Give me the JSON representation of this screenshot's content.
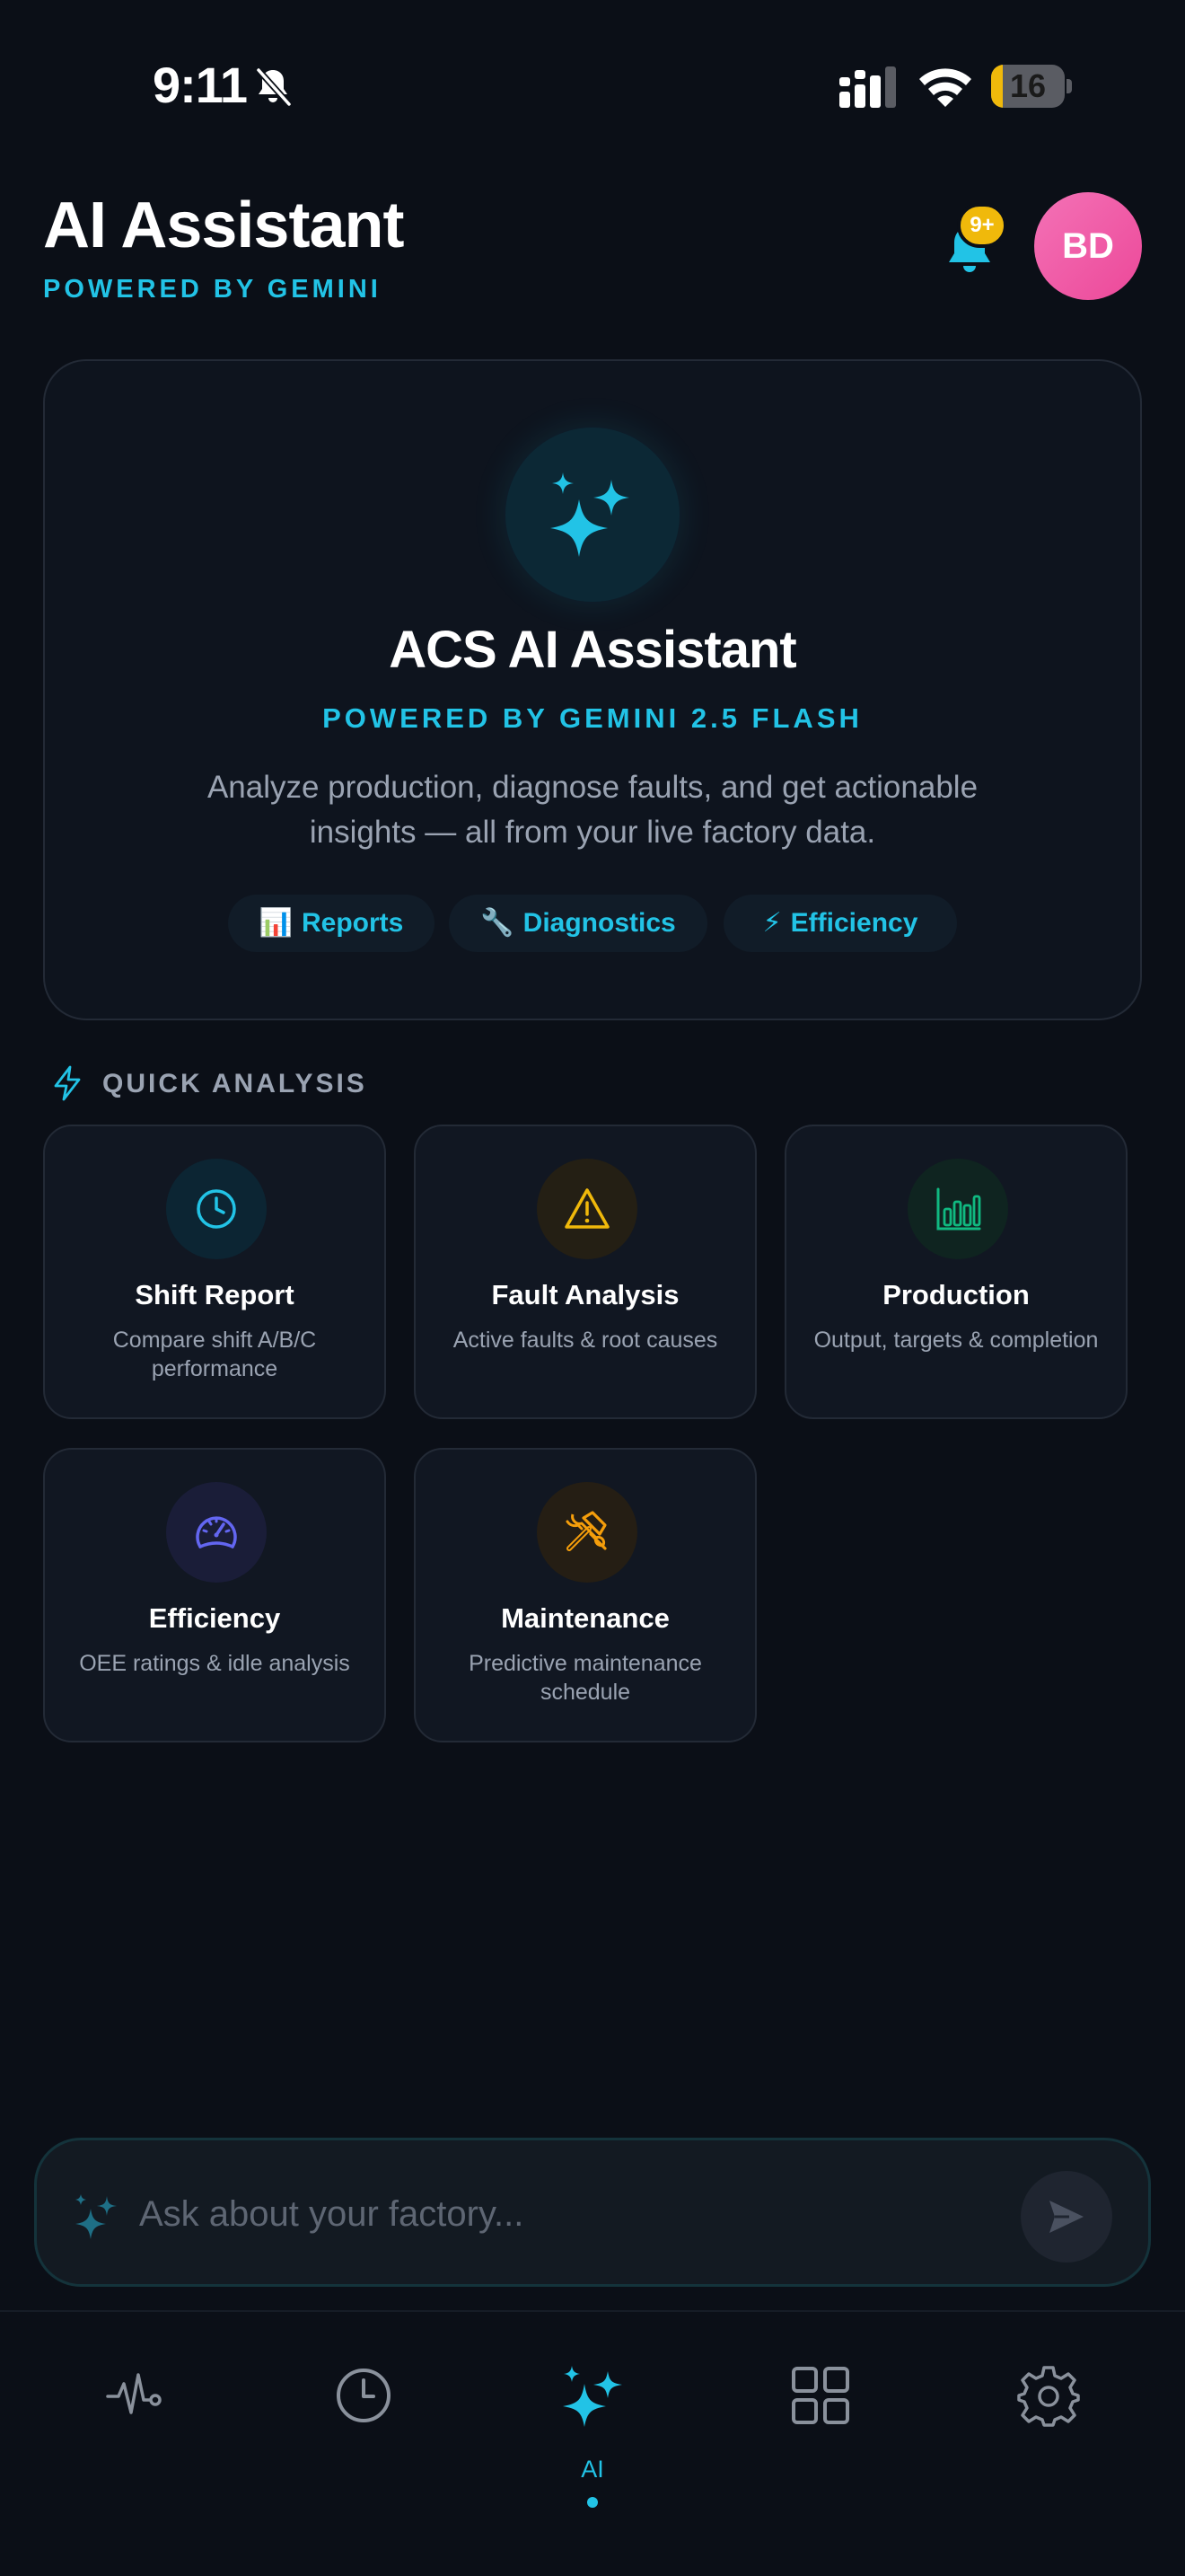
{
  "status_bar": {
    "time": "9:11",
    "battery": "16",
    "battery_level": 0.16
  },
  "header": {
    "title": "AI Assistant",
    "subtitle": "POWERED BY GEMINI",
    "notification_badge": "9+",
    "avatar_initials": "BD"
  },
  "hero": {
    "title": "ACS AI Assistant",
    "subtitle": "POWERED BY GEMINI 2.5 FLASH",
    "description": "Analyze production, diagnose faults, and get actionable insights — all from your live factory data.",
    "chips": [
      {
        "icon": "📊",
        "label": "Reports"
      },
      {
        "icon": "🔧",
        "label": "Diagnostics"
      },
      {
        "icon": "⚡",
        "label": "Efficiency"
      }
    ]
  },
  "quick_analysis": {
    "title": "QUICK ANALYSIS",
    "cards": [
      {
        "icon": "clock-icon",
        "title": "Shift Report",
        "description": "Compare shift A/B/C performance",
        "color": "#22c3e6"
      },
      {
        "icon": "warning-icon",
        "title": "Fault Analysis",
        "description": "Active faults & root causes",
        "color": "#f0b90b"
      },
      {
        "icon": "bar-chart-icon",
        "title": "Production",
        "description": "Output, targets & completion",
        "color": "#10b981"
      },
      {
        "icon": "speedometer-icon",
        "title": "Efficiency",
        "description": "OEE ratings & idle analysis",
        "color": "#6366f1"
      },
      {
        "icon": "tools-icon",
        "title": "Maintenance",
        "description": "Predictive maintenance schedule",
        "color": "#f59e0b"
      }
    ]
  },
  "chat": {
    "placeholder": "Ask about your factory..."
  },
  "nav": {
    "items": [
      {
        "icon": "pulse-icon",
        "label": ""
      },
      {
        "icon": "clock-icon",
        "label": ""
      },
      {
        "icon": "sparkles-icon",
        "label": "AI",
        "active": true
      },
      {
        "icon": "grid-icon",
        "label": ""
      },
      {
        "icon": "gear-icon",
        "label": ""
      }
    ]
  },
  "colors": {
    "accent": "#22c3e6",
    "background": "#0b0f17",
    "badge": "#f0b90b",
    "avatar": "#ec4899"
  }
}
